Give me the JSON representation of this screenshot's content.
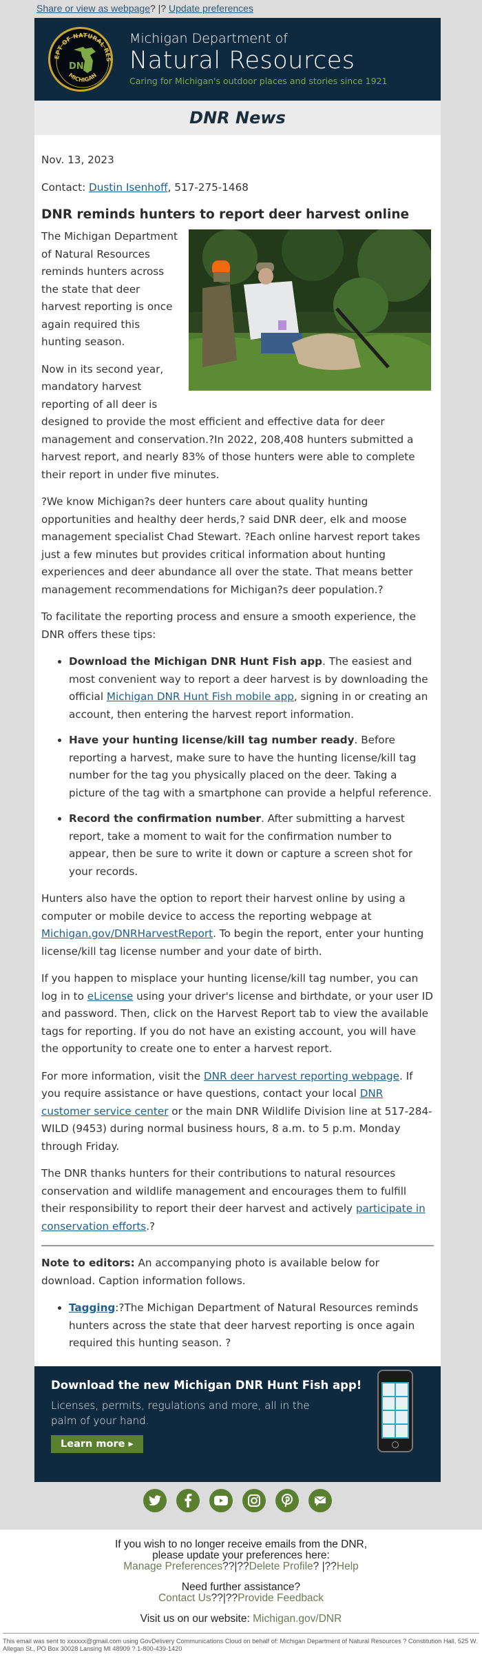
{
  "topbar": {
    "share_link": "Share or view as webpage",
    "separator": "? |? ",
    "update_link": "Update preferences"
  },
  "header": {
    "seal_icon": "dnr-seal-icon",
    "seal_top_text": "DEPARTMENT OF NATURAL RESOURCES",
    "seal_bottom_text": "MICHIGAN",
    "seal_center_text": "DNR",
    "line1": "Michigan Department of",
    "line2": "Natural Resources",
    "tagline": "Caring for Michigan's outdoor places and stories since 1921"
  },
  "newsbar": {
    "title": "DNR News"
  },
  "article": {
    "date": "Nov. 13, 2023",
    "contact_label": "Contact: ",
    "contact_name": "Dustin Isenhoff",
    "contact_phone": ", 517-275-1468",
    "headline": "DNR reminds hunters to report deer harvest online",
    "photo_alt": "Two hunters kneeling beside a harvested deer in tall grass, filling out a tag",
    "p1": "The Michigan Department of Natural Resources reminds hunters across the state that deer harvest reporting is once again required this hunting season.",
    "p2": "Now in its second year, mandatory harvest reporting of all deer is designed to provide the most efficient and effective data for deer management and conservation.?In 2022, 208,408 hunters submitted a harvest report, and nearly 83% of those hunters were able to complete their report in under five minutes.",
    "p3": "?We know Michigan?s deer hunters care about quality hunting opportunities and healthy deer herds,? said DNR deer, elk and moose management specialist Chad Stewart. ?Each online harvest report takes just a few minutes but provides critical information about hunting experiences and deer abundance all over the state. That means better management recommendations for Michigan?s deer population.?",
    "p4": "To facilitate the reporting process and ensure a smooth experience, the DNR offers these tips:",
    "tips": [
      {
        "bold": "Download the Michigan DNR Hunt Fish app",
        "text_before_link": ". The easiest and most convenient way to report a deer harvest is by downloading the official ",
        "link": "Michigan DNR Hunt Fish mobile app",
        "text_after_link": ", signing in or creating an account, then entering the harvest report information."
      },
      {
        "bold": "Have your hunting license/kill tag number ready",
        "text": ". Before reporting a harvest, make sure to have the hunting license/kill tag number for the tag you physically placed on the deer. Taking a picture of the tag with a smartphone can provide a helpful reference."
      },
      {
        "bold": "Record the confirmation number",
        "text": ". After submitting a harvest report, take a moment to wait for the confirmation number to appear, then be sure to write it down or capture a screen shot for your records."
      }
    ],
    "p5_before": "Hunters also have the option to report their harvest online by using a computer or mobile device to access the reporting webpage at ",
    "p5_link": "Michigan.gov/DNRHarvestReport",
    "p5_after": ". To begin the report, enter your hunting license/kill tag license number and your date of birth.",
    "p6_before": "If you happen to misplace your hunting license/kill tag number, you can log in to ",
    "p6_link": "eLicense",
    "p6_after": " using your driver's license and birthdate, or your user ID and password. Then, click on the Harvest Report tab to view the available tags for reporting. If you do not have an existing account, you will have the opportunity to create one to enter a harvest report.",
    "p7_before": "For more information, visit the ",
    "p7_link1": "DNR deer harvest reporting webpage",
    "p7_mid": ". If you require assistance or have questions, contact your local ",
    "p7_link2": "DNR customer service center",
    "p7_after": " or the main DNR Wildlife Division line at 517-284-WILD (9453) during normal business hours, 8 a.m. to 5 p.m. Monday through Friday.",
    "p8_before": "The DNR thanks hunters for their contributions to natural resources conservation and wildlife management and encourages them to fulfill their responsibility to report their deer harvest and actively ",
    "p8_link": "participate in conservation efforts",
    "p8_after": ".?",
    "note_bold": "Note to editors:",
    "note_text": " An accompanying photo is available below for download. Caption information follows.",
    "caption_link": "Tagging",
    "caption_text": ":?The Michigan Department of Natural Resources reminds hunters across the state that deer harvest reporting is once again required this hunting season. ?"
  },
  "promo": {
    "title": "Download the new Michigan DNR Hunt Fish app!",
    "subtitle": "Licenses, permits, regulations and more, all in the palm of your hand.",
    "button": "Learn more ▸",
    "phone_icon": "smartphone-app-icon"
  },
  "social": [
    {
      "name": "twitter-icon"
    },
    {
      "name": "facebook-icon"
    },
    {
      "name": "youtube-icon"
    },
    {
      "name": "instagram-icon"
    },
    {
      "name": "pinterest-icon"
    },
    {
      "name": "email-icon"
    }
  ],
  "footer": {
    "unsubscribe_line1": "If you wish to no longer receive emails from the DNR,",
    "unsubscribe_line2": "please update your preferences here:",
    "manage_prefs": "Manage Preferences",
    "sep1": "??|??",
    "delete_profile": "Delete Profile",
    "sep2": "? |??",
    "help": "Help",
    "assist_line": "Need further assistance?",
    "contact_us": "Contact Us",
    "sep3": "??|??",
    "feedback": "Provide Feedback",
    "website_label": "Visit us on our website: ",
    "website_link": "Michigan.gov/DNR",
    "legal": "This email was sent to xxxxxx@gmail.com using GovDelivery Communications Cloud on behalf of: Michigan Department of Natural Resources ? Constitution Hall, 525 W. Allegan St., PO Box 30028 Lansing MI 48909 ? 1-800-439-1420"
  },
  "colors": {
    "navy": "#0f2a3f",
    "green": "#5a7f2f",
    "tagline_green": "#7faa45",
    "link_blue": "#1f5f8b",
    "footer_link": "#6b7b56",
    "page_gray": "#dcdcdc"
  }
}
